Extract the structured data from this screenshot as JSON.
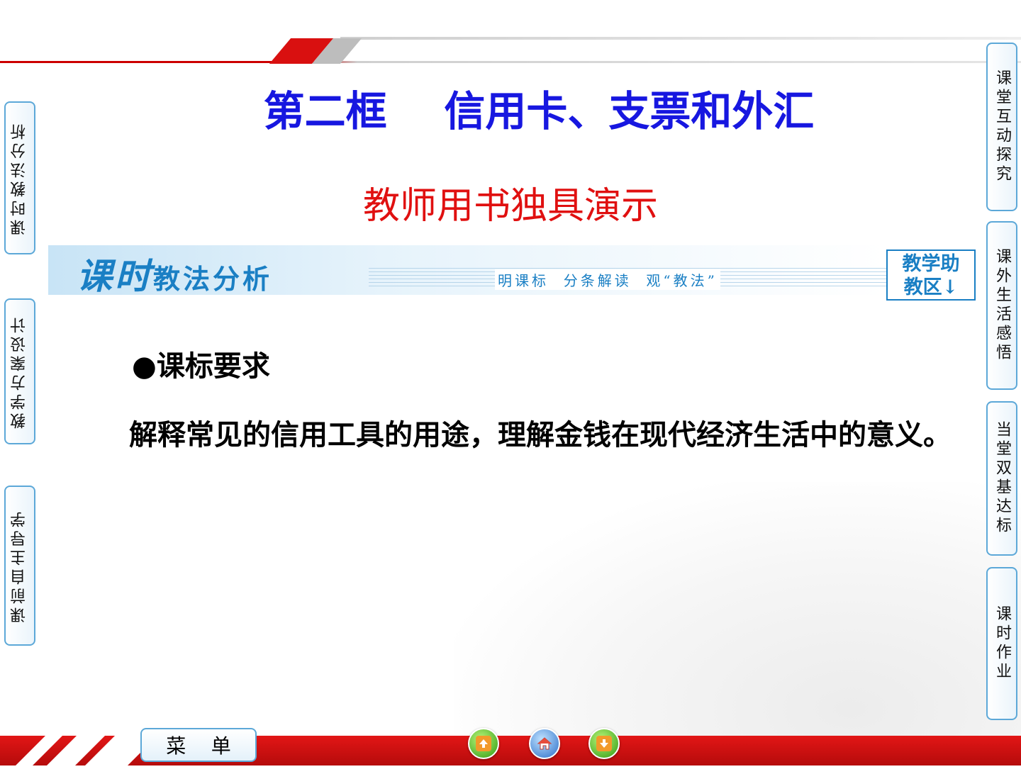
{
  "title": "第二框    信用卡、支票和外汇",
  "subtitle": "教师用书独具演示",
  "banner": {
    "head_big": "课时",
    "head_rest": "教法分析",
    "tagline": "明课标  分条解读  观“教法”",
    "assist_line1": "教学助",
    "assist_line2": "教区↓"
  },
  "left_tabs": [
    {
      "label": "课时教法分析"
    },
    {
      "label": "教学方案设计"
    },
    {
      "label": "课前自主导学"
    }
  ],
  "right_tabs": [
    {
      "label": "课堂互动探究"
    },
    {
      "label": "课外生活感悟"
    },
    {
      "label": "当堂双基达标"
    },
    {
      "label": "课时作业"
    }
  ],
  "content": {
    "heading": "●课标要求",
    "body": "解释常见的信用工具的用途，理解金钱在现代经济生活中的意义。"
  },
  "footer": {
    "menu_label": "菜    单",
    "nav": {
      "prev_icon": "up-arrow-icon",
      "home_icon": "home-icon",
      "next_icon": "down-arrow-icon"
    }
  },
  "colors": {
    "title": "#1717e0",
    "subtitle": "#e01010",
    "accent": "#1a7fc4",
    "bar": "#d91010"
  }
}
